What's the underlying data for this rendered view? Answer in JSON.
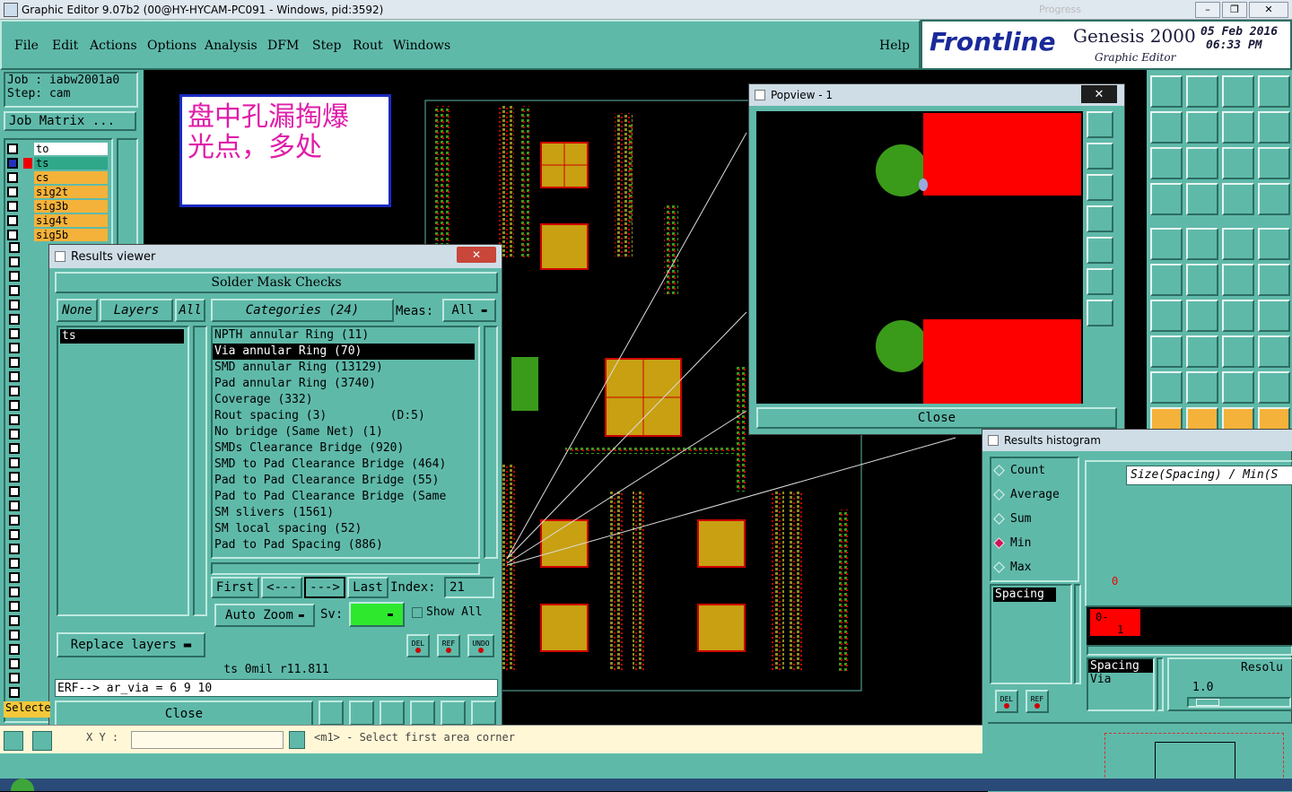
{
  "window": {
    "title": "Graphic Editor 9.07b2 (00@HY-HYCAM-PC091 - Windows, pid:3592)",
    "progress_text": "Progress"
  },
  "menu": [
    "File",
    "Edit",
    "Actions",
    "Options",
    "Analysis",
    "DFM",
    "Step",
    "Rout",
    "Windows"
  ],
  "help": "Help",
  "brand": {
    "logo": "Frontline",
    "product": "Genesis 2000",
    "subtitle": "Graphic Editor",
    "date": "05 Feb 2016",
    "time": "06:33 PM"
  },
  "job": {
    "job_label": "Job : iabw2001a0",
    "step_label": "Step: cam",
    "matrix_button": "Job Matrix ..."
  },
  "layers": [
    {
      "name": "to",
      "color": "#ffffff"
    },
    {
      "name": "ts",
      "color": "#2fa88a"
    },
    {
      "name": "cs",
      "color": "#f5b23a"
    },
    {
      "name": "sig2t",
      "color": "#f5b23a"
    },
    {
      "name": "sig3b",
      "color": "#f5b23a"
    },
    {
      "name": "sig4t",
      "color": "#f5b23a"
    },
    {
      "name": "sig5b",
      "color": "#f5b23a"
    }
  ],
  "annotation": {
    "line1": "盘中孔漏掏爆",
    "line2": "光点，多处"
  },
  "results_viewer": {
    "title": "Results viewer",
    "header": "Solder Mask Checks",
    "none_btn": "None",
    "layers_btn": "Layers",
    "all_btn": "All",
    "layers_list": [
      "ts"
    ],
    "categories_label": "Categories (24)",
    "meas_label": "Meas:",
    "meas_value": "All",
    "categories": [
      "NPTH annular Ring (11)",
      "Via annular Ring (70)",
      "SMD annular Ring (13129)",
      "Pad annular Ring (3740)",
      "Coverage (332)",
      "Rout spacing (3)         (D:5)",
      "No bridge (Same Net) (1)",
      "SMDs Clearance Bridge (920)",
      "SMD to Pad Clearance Bridge (464)",
      "Pad to Pad Clearance Bridge (55)",
      "Pad to Pad Clearance Bridge (Same",
      "SM slivers (1561)",
      "SM local spacing (52)",
      "Pad to Pad Spacing (886)"
    ],
    "selected_index": 1,
    "first_btn": "First",
    "prev_btn": "<---",
    "next_btn": "--->",
    "last_btn": "Last",
    "index_label": "Index:",
    "index_value": "21",
    "auto_zoom": "Auto Zoom",
    "sv_label": "Sv:",
    "show_all": "Show All",
    "replace_layers": "Replace layers",
    "del_label": "DEL",
    "ref_label": "REF",
    "undo_label": "UNDO",
    "status_line": "ts 0mil  r11.811",
    "erf_line": "ERF--> ar_via = 6 9 10",
    "close_btn": "Close"
  },
  "popview": {
    "title": "Popview - 1",
    "close_btn": "Close"
  },
  "histogram": {
    "title": "Results histogram",
    "options": [
      {
        "label": "Count",
        "selected": false
      },
      {
        "label": "Average",
        "selected": false
      },
      {
        "label": "Sum",
        "selected": false
      },
      {
        "label": "Min",
        "selected": true
      },
      {
        "label": "Max",
        "selected": false
      }
    ],
    "header_text": "Size(Spacing) / Min(S",
    "list_selected": "Spacing",
    "bar_top_label": "0",
    "bar_text_a": "0-",
    "bar_text_b": "1",
    "lower_list": [
      "Spacing",
      "Via"
    ],
    "resolution_label": "Resolu",
    "resolution_value": "1.0",
    "del_label": "DEL",
    "ref_label": "REF"
  },
  "statusbar": {
    "selected": "Selecte",
    "xy_label": "X Y :",
    "prompt": "<m1> - Select first area corner"
  },
  "colors": {
    "panel": "#5fb9a9",
    "accent_red": "#ff0000",
    "pad_green": "#3a9a1a",
    "pad_yellow": "#c8a012"
  }
}
